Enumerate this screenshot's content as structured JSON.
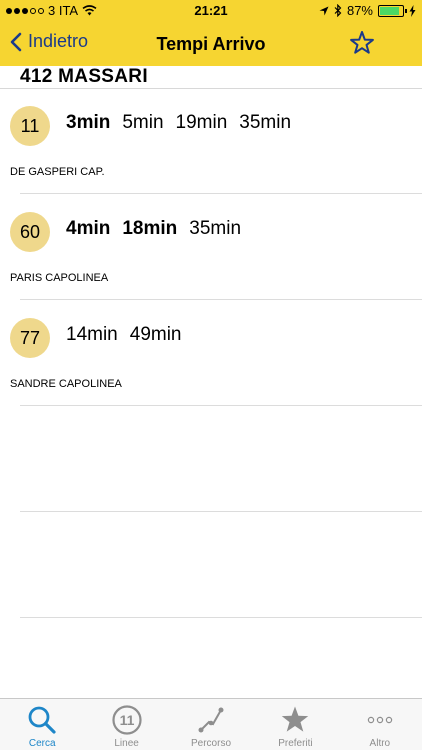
{
  "status_bar": {
    "carrier": "3 ITA",
    "time": "21:21",
    "battery_percent": "87%",
    "battery_level": 0.87
  },
  "nav": {
    "back_label": "Indietro",
    "title": "Tempi Arrivo"
  },
  "stop": {
    "name": "412 MASSARI"
  },
  "arrivals": [
    {
      "line": "11",
      "times": [
        {
          "label": "3min",
          "bold": true
        },
        {
          "label": "5min",
          "bold": false
        },
        {
          "label": "19min",
          "bold": false
        },
        {
          "label": "35min",
          "bold": false
        }
      ],
      "destination": "DE GASPERI CAP."
    },
    {
      "line": "60",
      "times": [
        {
          "label": "4min",
          "bold": true
        },
        {
          "label": "18min",
          "bold": true
        },
        {
          "label": "35min",
          "bold": false
        }
      ],
      "destination": "PARIS CAPOLINEA"
    },
    {
      "line": "77",
      "times": [
        {
          "label": "14min",
          "bold": false
        },
        {
          "label": "49min",
          "bold": false
        }
      ],
      "destination": "SANDRE CAPOLINEA"
    }
  ],
  "tabs": [
    {
      "label": "Cerca",
      "icon": "search-icon",
      "active": true
    },
    {
      "label": "Linee",
      "icon": "line-number-icon",
      "badge": "11",
      "active": false
    },
    {
      "label": "Percorso",
      "icon": "route-icon",
      "active": false
    },
    {
      "label": "Preferiti",
      "icon": "star-icon",
      "active": false
    },
    {
      "label": "Altro",
      "icon": "more-icon",
      "active": false
    }
  ],
  "colors": {
    "bar_yellow": "#f6d531",
    "badge_fill": "#efd88c",
    "nav_blue": "#1a3a8a",
    "tab_active": "#1e86c8",
    "tab_inactive": "#8e8e8e"
  }
}
